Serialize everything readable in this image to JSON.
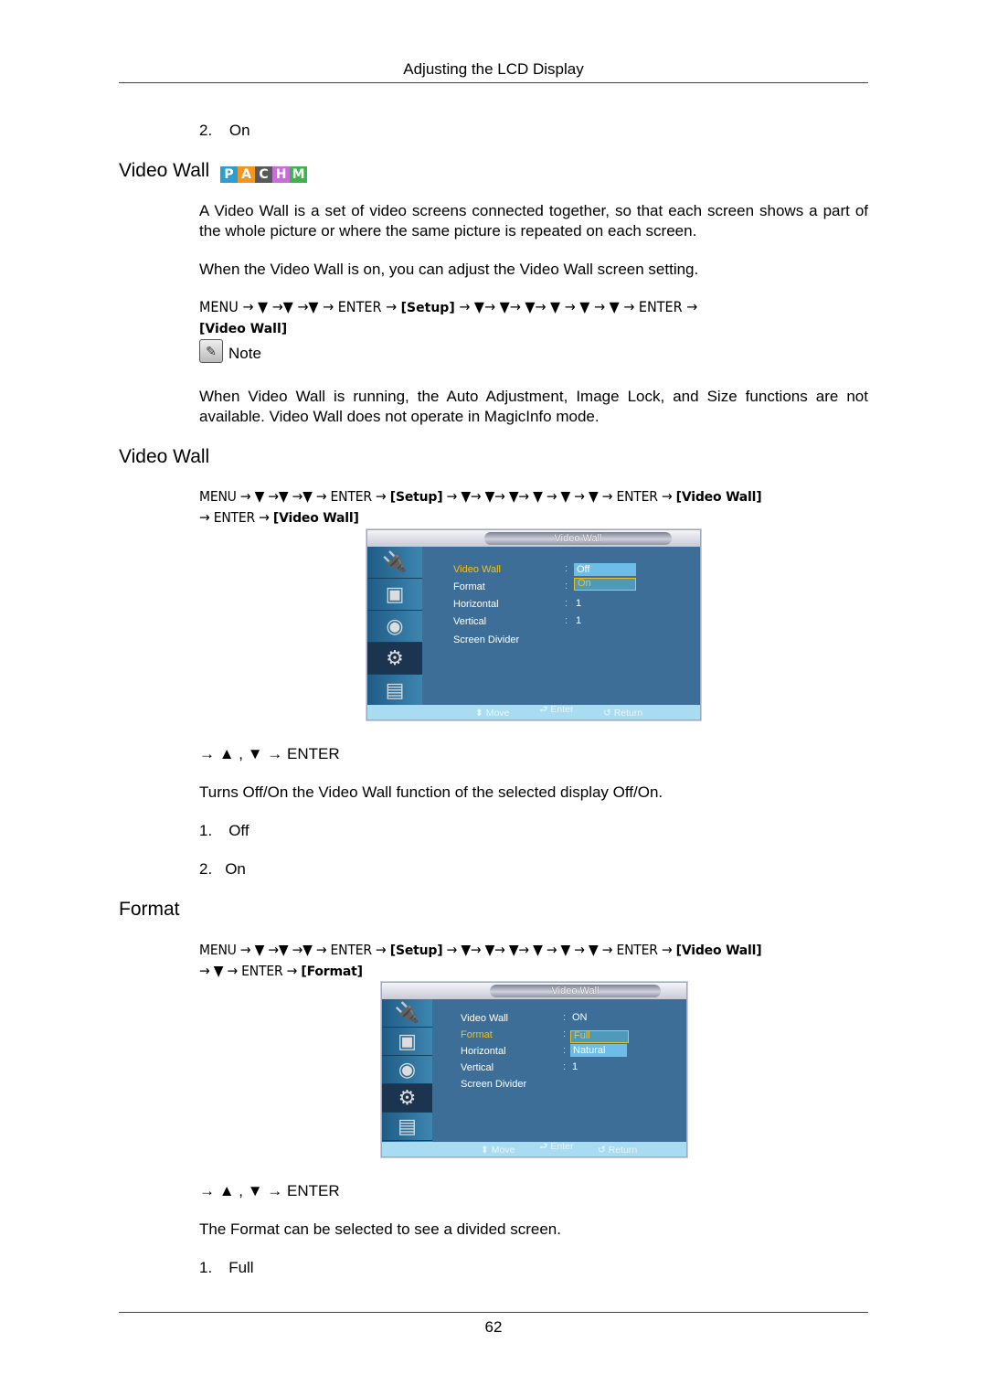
{
  "header": {
    "running_head": "Adjusting the LCD Display"
  },
  "top_list": {
    "num": "2.",
    "label": "On"
  },
  "video_wall_section": {
    "heading": "Video Wall",
    "badges": [
      {
        "letter": "P",
        "color": "#2a9fd6"
      },
      {
        "letter": "A",
        "color": "#f7941d"
      },
      {
        "letter": "C",
        "color": "#58595b"
      },
      {
        "letter": "H",
        "color": "#c86dd7"
      },
      {
        "letter": "M",
        "color": "#39b54a"
      }
    ],
    "para1_a": "A ",
    "para1_term": "Video Wall",
    "para1_b": " is a set of video screens connected together, so that each screen shows a part of the whole picture or where the same picture is repeated on each screen.",
    "para2_a": "When the ",
    "para2_term1": "Video Wall",
    "para2_b": " is on, you can adjust the ",
    "para2_term2": "Video Wall",
    "para2_c": " screen setting.",
    "sequence": "MENU → ▼ →▼ →▼ → ENTER → ",
    "seq_setup": "[Setup]",
    "sequence_b": " → ▼→ ▼→ ▼→ ▼ → ▼ → ▼ → ENTER →",
    "seq_target": "[Video Wall]",
    "note_label": "Note",
    "note_text": {
      "a": "When ",
      "t1": "Video Wall",
      "b": " is running, the ",
      "t2": "Auto Adjustment",
      "c": ", ",
      "t3": "Image Lock",
      "d": ", and ",
      "t4": "Size",
      "e": " functions are not available. ",
      "t5": "Video Wall",
      "f": " does not operate in ",
      "t6": "MagicInfo",
      "g": " mode."
    }
  },
  "video_wall_sub": {
    "heading": "Video Wall",
    "seq_a": "MENU → ▼ →▼ →▼ → ENTER → ",
    "seq_setup": "[Setup]",
    "seq_b": " → ▼→ ▼→ ▼→ ▼ → ▼ → ▼ → ENTER → ",
    "seq_vw": "[Video Wall]",
    "seq_c": "→ ENTER → ",
    "seq_target": "[Video Wall]",
    "osd": {
      "title": "Video Wall",
      "rows": [
        {
          "label": "Video Wall",
          "value": ""
        },
        {
          "label": "Format",
          "value": ""
        },
        {
          "label": "Horizontal",
          "value": "1"
        },
        {
          "label": "Vertical",
          "value": "1"
        },
        {
          "label": "Screen Divider",
          "value": ""
        }
      ],
      "options": [
        "Off",
        "On"
      ],
      "hints": {
        "move": "Move",
        "enter": "Enter",
        "return": "Return"
      }
    },
    "nav": "→ ▲ , ▼ → ENTER",
    "desc_a": "Turns Off/On the ",
    "desc_term": "Video Wall",
    "desc_b": " function of the selected display Off/On.",
    "list": [
      {
        "num": "1.",
        "label": "Off"
      },
      {
        "num": "2.",
        "label": "On"
      }
    ]
  },
  "format_sub": {
    "heading": "Format",
    "seq_a": "MENU → ▼ →▼ →▼ → ENTER → ",
    "seq_setup": "[Setup]",
    "seq_b": " → ▼→ ▼→ ▼→ ▼ → ▼ → ▼ → ENTER → ",
    "seq_vw": "[Video Wall]",
    "seq_c": "→ ▼ → ENTER → ",
    "seq_target": "[Format]",
    "osd": {
      "title": "Video Wall",
      "rows": [
        {
          "label": "Video Wall",
          "value": "ON"
        },
        {
          "label": "Format",
          "value": ""
        },
        {
          "label": "Horizontal",
          "value": ""
        },
        {
          "label": "Vertical",
          "value": "1"
        },
        {
          "label": "Screen Divider",
          "value": ""
        }
      ],
      "options": [
        "Full",
        "Natural"
      ],
      "hints": {
        "move": "Move",
        "enter": "Enter",
        "return": "Return"
      }
    },
    "nav": "→ ▲ , ▼ → ENTER",
    "desc_a": "The ",
    "desc_term": "Format",
    "desc_b": " can be selected to see a divided screen.",
    "list": [
      {
        "num": "1.",
        "label": "Full"
      }
    ]
  },
  "footer": {
    "page_number": "62"
  }
}
